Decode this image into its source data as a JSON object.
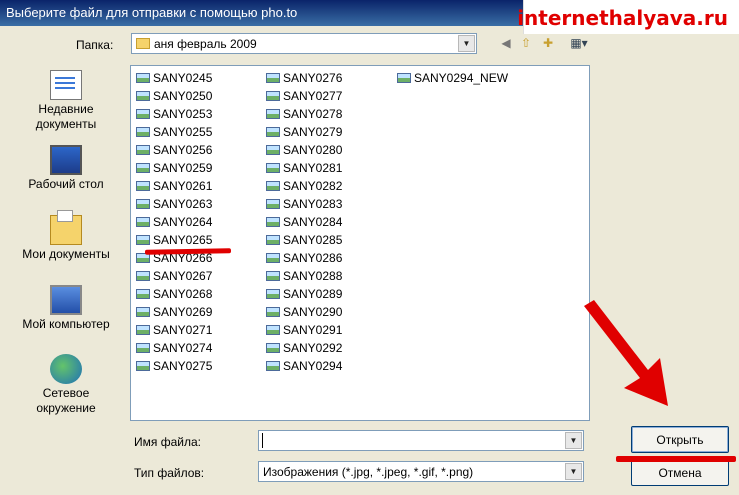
{
  "window": {
    "title": "Выберите файл для отправки с помощью pho.to"
  },
  "watermark": {
    "text": "internethalyava.ru"
  },
  "folder_row": {
    "label": "Папка:",
    "current_folder": "аня февраль 2009",
    "tools": [
      "back-icon",
      "up-folder-icon",
      "new-folder-icon",
      "view-menu-icon"
    ]
  },
  "places": [
    {
      "label_line1": "Недавние",
      "label_line2": "документы",
      "icon": "recent-docs-icon"
    },
    {
      "label_line1": "Рабочий стол",
      "label_line2": "",
      "icon": "desktop-icon"
    },
    {
      "label_line1": "Мои документы",
      "label_line2": "",
      "icon": "my-documents-icon"
    },
    {
      "label_line1": "Мой компьютер",
      "label_line2": "",
      "icon": "my-computer-icon"
    },
    {
      "label_line1": "Сетевое",
      "label_line2": "окружение",
      "icon": "network-icon"
    }
  ],
  "files": {
    "col1": [
      "SANY0245",
      "SANY0250",
      "SANY0253",
      "SANY0255",
      "SANY0256",
      "SANY0259",
      "SANY0261",
      "SANY0263",
      "SANY0264",
      "SANY0265",
      "SANY0266",
      "SANY0267",
      "SANY0268",
      "SANY0269",
      "SANY0271",
      "SANY0274",
      "SANY0275"
    ],
    "col2": [
      "SANY0276",
      "SANY0277",
      "SANY0278",
      "SANY0279",
      "SANY0280",
      "SANY0281",
      "SANY0282",
      "SANY0283",
      "SANY0284",
      "SANY0285",
      "SANY0286",
      "SANY0288",
      "SANY0289",
      "SANY0290",
      "SANY0291",
      "SANY0292",
      "SANY0294"
    ],
    "col3": [
      "SANY0294_NEW"
    ]
  },
  "filename": {
    "label": "Имя файла:",
    "value": ""
  },
  "filetype": {
    "label": "Тип файлов:",
    "value": "Изображения (*.jpg, *.jpeg, *.gif, *.png)"
  },
  "buttons": {
    "open": "Открыть",
    "cancel": "Отмена"
  },
  "colors": {
    "annotation": "#e00000",
    "titlebar": "#0a246a"
  }
}
